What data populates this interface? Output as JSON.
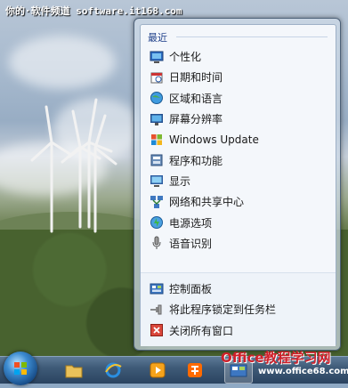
{
  "watermark": "你的·软件频道 software.it168.com",
  "jumplist": {
    "recent_title": "最近",
    "recent_items": [
      {
        "label": "个性化",
        "icon": "personalization-icon"
      },
      {
        "label": "日期和时间",
        "icon": "date-time-icon"
      },
      {
        "label": "区域和语言",
        "icon": "region-language-icon"
      },
      {
        "label": "屏幕分辨率",
        "icon": "screen-resolution-icon"
      },
      {
        "label": "Windows Update",
        "icon": "windows-update-icon"
      },
      {
        "label": "程序和功能",
        "icon": "programs-features-icon"
      },
      {
        "label": "显示",
        "icon": "display-icon"
      },
      {
        "label": "网络和共享中心",
        "icon": "network-sharing-icon"
      },
      {
        "label": "电源选项",
        "icon": "power-options-icon"
      },
      {
        "label": "语音识别",
        "icon": "speech-recognition-icon"
      }
    ],
    "tasks": [
      {
        "label": "控制面板",
        "icon": "control-panel-icon"
      },
      {
        "label": "将此程序锁定到任务栏",
        "icon": "pin-icon"
      },
      {
        "label": "关闭所有窗口",
        "icon": "close-window-icon"
      }
    ]
  },
  "brand": {
    "name": "Office教程学习网",
    "url": "www.office68.com"
  },
  "colors": {
    "title_blue": "#1e3f8a",
    "brand_red": "#d0202a"
  }
}
